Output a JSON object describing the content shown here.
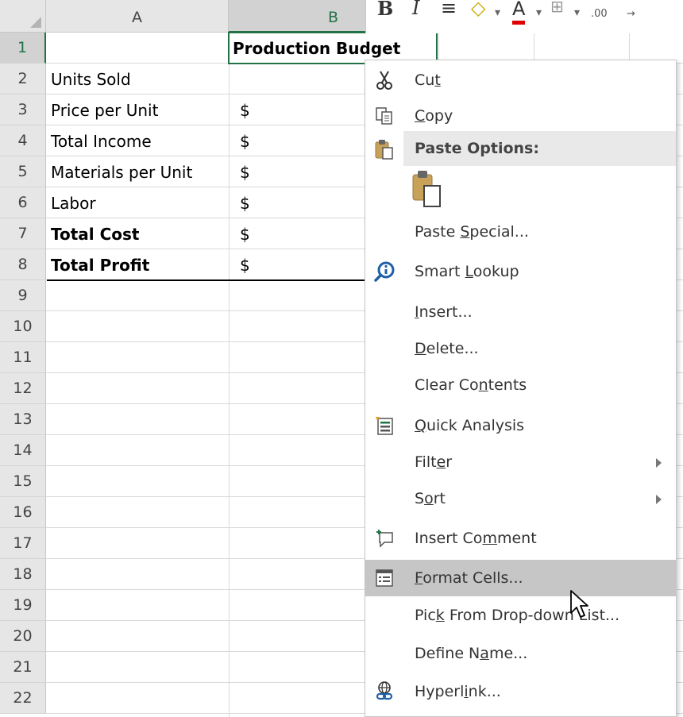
{
  "columns": [
    {
      "label": "A",
      "selected": false
    },
    {
      "label": "B",
      "selected": true
    }
  ],
  "rows": [
    {
      "n": "1",
      "a": "",
      "b": "Production Budget",
      "bold_a": false,
      "bold_b": true
    },
    {
      "n": "2",
      "a": "Units Sold",
      "b": "",
      "bold_a": false
    },
    {
      "n": "3",
      "a": "Price per Unit",
      "b": "$",
      "bold_a": false
    },
    {
      "n": "4",
      "a": "Total Income",
      "b": "$",
      "bold_a": false
    },
    {
      "n": "5",
      "a": "Materials per Unit",
      "b": "$",
      "bold_a": false
    },
    {
      "n": "6",
      "a": "Labor",
      "b": "$",
      "bold_a": false
    },
    {
      "n": "7",
      "a": "Total Cost",
      "b": "$",
      "bold_a": true
    },
    {
      "n": "8",
      "a": "Total Profit",
      "b": "$",
      "bold_a": true
    },
    {
      "n": "9",
      "a": "",
      "b": ""
    },
    {
      "n": "10",
      "a": "",
      "b": ""
    },
    {
      "n": "11",
      "a": "",
      "b": ""
    },
    {
      "n": "12",
      "a": "",
      "b": ""
    },
    {
      "n": "13",
      "a": "",
      "b": ""
    },
    {
      "n": "14",
      "a": "",
      "b": ""
    },
    {
      "n": "15",
      "a": "",
      "b": ""
    },
    {
      "n": "16",
      "a": "",
      "b": ""
    },
    {
      "n": "17",
      "a": "",
      "b": ""
    },
    {
      "n": "18",
      "a": "",
      "b": ""
    },
    {
      "n": "19",
      "a": "",
      "b": ""
    },
    {
      "n": "20",
      "a": "",
      "b": ""
    },
    {
      "n": "21",
      "a": "",
      "b": ""
    },
    {
      "n": "22",
      "a": "",
      "b": ""
    }
  ],
  "selected_cell": "B1",
  "mini_toolbar": {
    "bold": "B",
    "italic": "I",
    "align": "≡",
    "font_color_glyph": "A",
    "decimals": ".00"
  },
  "context_menu": {
    "cut": {
      "pre": "Cu",
      "acc": "t",
      "post": ""
    },
    "copy": {
      "pre": "",
      "acc": "C",
      "post": "opy"
    },
    "paste_options": "Paste Options:",
    "paste_special": {
      "pre": "Paste ",
      "acc": "S",
      "post": "pecial..."
    },
    "smart_lookup": {
      "pre": "Smart ",
      "acc": "L",
      "post": "ookup"
    },
    "insert": {
      "pre": "",
      "acc": "I",
      "post": "nsert..."
    },
    "delete": {
      "pre": "",
      "acc": "D",
      "post": "elete..."
    },
    "clear_contents": {
      "pre": "Clear Co",
      "acc": "n",
      "post": "tents"
    },
    "quick_analysis": {
      "pre": "",
      "acc": "Q",
      "post": "uick Analysis"
    },
    "filter": {
      "pre": "Filt",
      "acc": "e",
      "post": "r"
    },
    "sort": {
      "pre": "S",
      "acc": "o",
      "post": "rt"
    },
    "insert_comment": {
      "pre": "Insert Co",
      "acc": "m",
      "post": "ment"
    },
    "format_cells": {
      "pre": "",
      "acc": "F",
      "post": "ormat Cells..."
    },
    "pick_list": {
      "pre": "Pic",
      "acc": "k",
      "post": " From Drop-down List..."
    },
    "define_name": {
      "pre": "Define N",
      "acc": "a",
      "post": "me..."
    },
    "hyperlink": {
      "pre": "Hyperl",
      "acc": "i",
      "post": "nk..."
    }
  },
  "colors": {
    "accent": "#217346",
    "menu_hover": "#c6c6c6",
    "header_bg": "#e6e6e6"
  },
  "icons": [
    "scissors-icon",
    "copy-icon",
    "clipboard-icon",
    "paste-icon",
    "smart-lookup-icon",
    "quick-analysis-icon",
    "comment-icon",
    "format-cells-icon",
    "hyperlink-icon",
    "submenu-arrow-icon",
    "mouse-cursor-icon"
  ]
}
